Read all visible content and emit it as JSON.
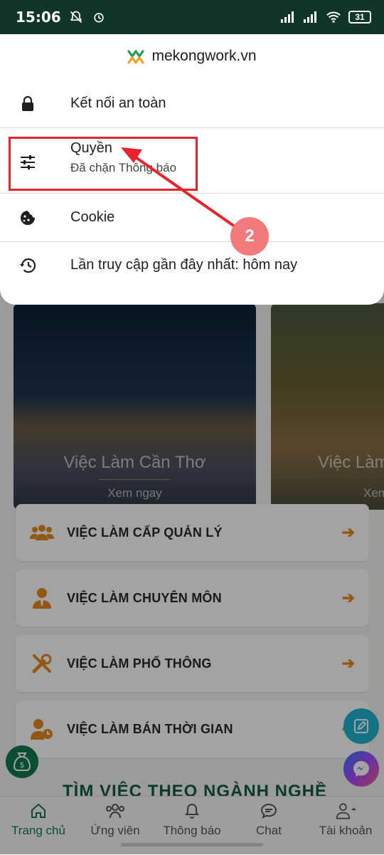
{
  "status_bar": {
    "time": "15:06",
    "battery": "31"
  },
  "popup": {
    "site": "mekongwork.vn",
    "rows": [
      {
        "title": "Kết nối an toàn",
        "icon": "lock-icon"
      },
      {
        "title": "Quyền",
        "subtitle": "Đã chặn Thông báo",
        "icon": "tune-icon"
      },
      {
        "title": "Cookie",
        "icon": "cookie-icon"
      },
      {
        "title": "Lần truy cập gần đây nhất: hôm nay",
        "icon": "history-icon"
      }
    ]
  },
  "annotation": {
    "step": "2",
    "color": "#e8232b"
  },
  "cards": [
    {
      "title": "Việc Làm Cần Thơ",
      "action": "Xem ngay"
    },
    {
      "title": "Việc Làm",
      "action": "Xem"
    }
  ],
  "jobs": [
    {
      "label": "VIỆC LÀM CẤP QUẢN LÝ",
      "icon": "users-icon"
    },
    {
      "label": "VIỆC LÀM CHUYÊN MÔN",
      "icon": "user-tie-icon"
    },
    {
      "label": "VIỆC LÀM PHỔ THÔNG",
      "icon": "tools-icon"
    },
    {
      "label": "VIỆC LÀM BÁN THỜI GIAN",
      "icon": "user-clock-icon"
    }
  ],
  "section_title": "TÌM VIỆC THEO NGÀNH NGHỀ",
  "nav": [
    {
      "label": "Trang chủ",
      "icon": "home-icon",
      "active": true
    },
    {
      "label": "Ứng viên",
      "icon": "people-icon"
    },
    {
      "label": "Thông báo",
      "icon": "bell-icon"
    },
    {
      "label": "Chat",
      "icon": "chat-icon"
    },
    {
      "label": "Tài khoản",
      "icon": "account-icon"
    }
  ],
  "colors": {
    "brand_green": "#0f7a4e",
    "status_bar": "#10362a",
    "accent_orange": "#e58a1f"
  }
}
